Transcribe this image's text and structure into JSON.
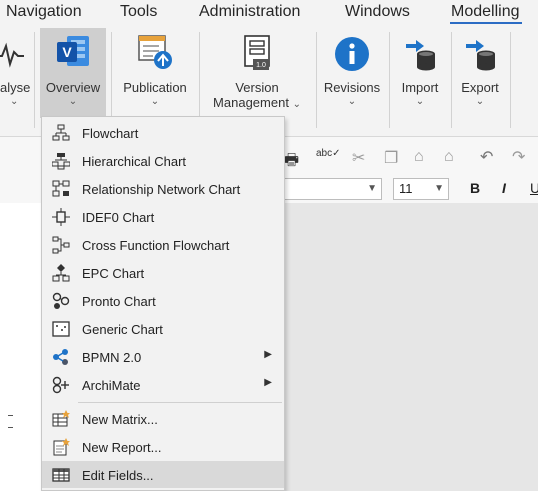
{
  "menubar": {
    "items": [
      "Navigation",
      "Tools",
      "Administration",
      "Windows",
      "Modelling"
    ],
    "active": "Modelling"
  },
  "ribbon": {
    "analyse_label": "alyse",
    "overview_label": "Overview",
    "publication_label": "Publication",
    "version_line1": "Version",
    "version_line2": "Management",
    "revisions_label": "Revisions",
    "import_label": "Import",
    "export_label": "Export",
    "chevron": "⌄"
  },
  "toolbar2": {
    "font_size": "11",
    "bold": "B",
    "italic": "I",
    "underline": "U"
  },
  "dropdown": {
    "items": [
      {
        "label": "Flowchart",
        "icon": "flowchart-icon",
        "submenu": false
      },
      {
        "label": "Hierarchical Chart",
        "icon": "hierarchy-icon",
        "submenu": false
      },
      {
        "label": "Relationship Network Chart",
        "icon": "network-icon",
        "submenu": false
      },
      {
        "label": "IDEF0 Chart",
        "icon": "idef0-icon",
        "submenu": false
      },
      {
        "label": "Cross Function Flowchart",
        "icon": "cross-function-icon",
        "submenu": false
      },
      {
        "label": "EPC Chart",
        "icon": "epc-icon",
        "submenu": false
      },
      {
        "label": "Pronto Chart",
        "icon": "pronto-icon",
        "submenu": false
      },
      {
        "label": "Generic Chart",
        "icon": "generic-chart-icon",
        "submenu": false
      },
      {
        "label": "BPMN 2.0",
        "icon": "bpmn-icon",
        "submenu": true
      },
      {
        "label": "ArchiMate",
        "icon": "archimate-icon",
        "submenu": true
      },
      {
        "label": "New Matrix...",
        "icon": "matrix-icon",
        "submenu": false
      },
      {
        "label": "New Report...",
        "icon": "report-icon",
        "submenu": false
      },
      {
        "label": "Edit Fields...",
        "icon": "table-icon",
        "submenu": false
      }
    ],
    "highlighted": "Edit Fields...",
    "submenu_arrow": "▶"
  },
  "colors": {
    "accent": "#2b6cc4",
    "brand_blue": "#1e73c8",
    "ribbon_bg": "#f3f3f3",
    "menu_bg": "#f2f2f2",
    "highlight": "#d9d9d9",
    "content_bg": "#e6e6e6"
  }
}
